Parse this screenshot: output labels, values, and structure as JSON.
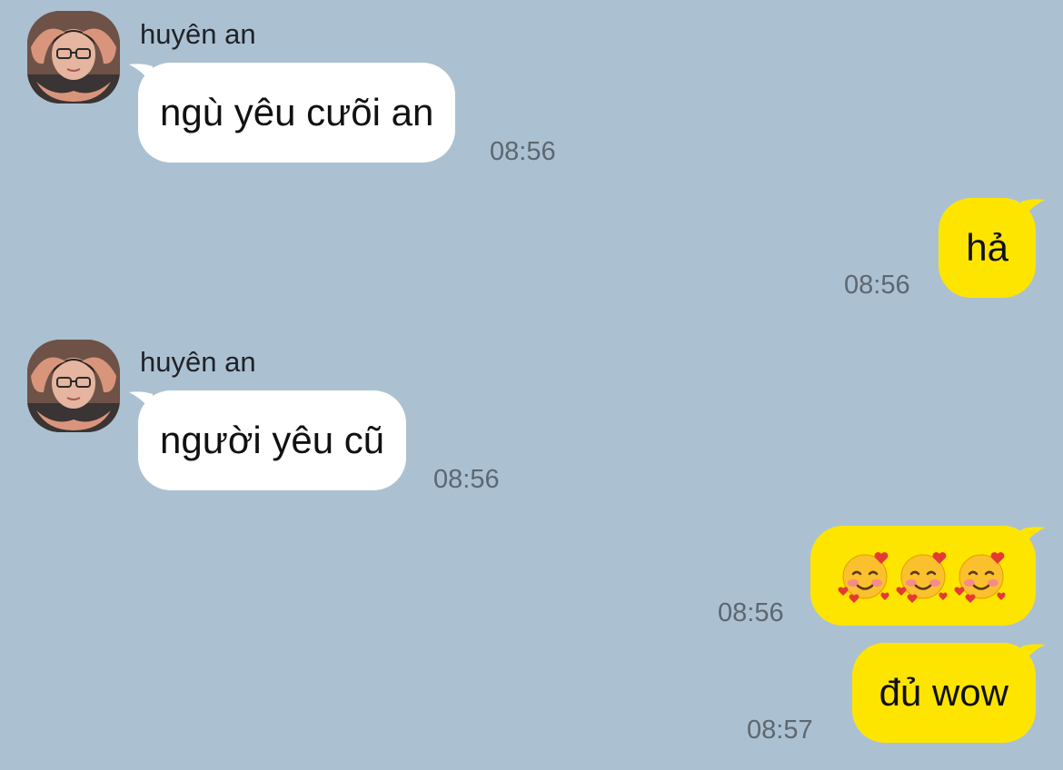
{
  "messages": [
    {
      "direction": "incoming",
      "sender": "huyên an",
      "text": "ngù yêu cưõi an",
      "time": "08:56"
    },
    {
      "direction": "outgoing",
      "text": "hả",
      "time": "08:56"
    },
    {
      "direction": "incoming",
      "sender": "huyên an",
      "text": "người yêu cũ",
      "time": "08:56"
    },
    {
      "direction": "outgoing",
      "emoji": [
        "smiling-face-with-hearts",
        "smiling-face-with-hearts",
        "smiling-face-with-hearts"
      ],
      "time": "08:56"
    },
    {
      "direction": "outgoing",
      "text": "đủ wow",
      "time": "08:57"
    }
  ],
  "colors": {
    "background": "#abc1d1",
    "incoming_bubble": "#ffffff",
    "outgoing_bubble": "#fee500",
    "timestamp": "#5d6770"
  }
}
